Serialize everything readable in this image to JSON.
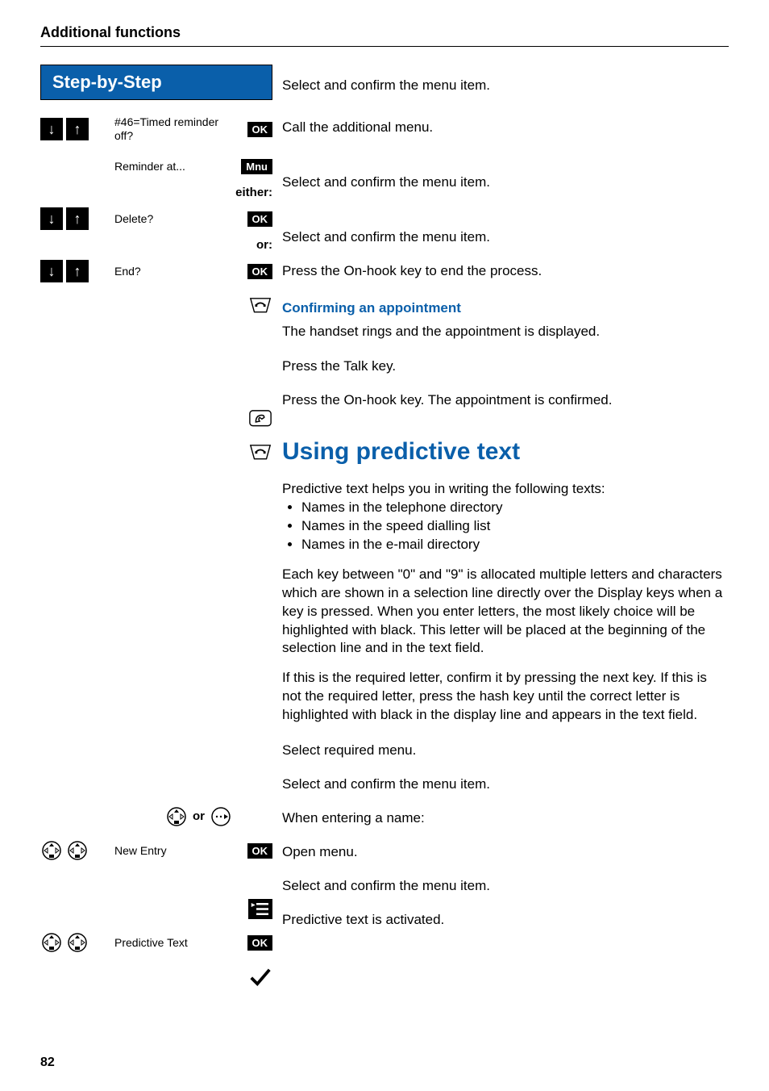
{
  "chapter": "Additional functions",
  "stepbox": "Step-by-Step",
  "left": {
    "row1_menu": "#46=Timed reminder off?",
    "row2_menu": "Reminder at...",
    "either": "either:",
    "row3_menu": "Delete?",
    "or": "or:",
    "row4_menu": "End?",
    "or2": "or",
    "new_entry": "New Entry",
    "predictive_text_item": "Predictive Text"
  },
  "buttons": {
    "ok": "OK",
    "mnu": "Mnu"
  },
  "right": {
    "r1": "Select and confirm the menu item.",
    "r2": "Call the additional menu.",
    "r3": "Select and confirm the menu item.",
    "r4": "Select and confirm the menu item.",
    "r5": "Press the On-hook key to end the process.",
    "subhead1": "Confirming an appointment",
    "r6": "The handset rings and the appointment is displayed.",
    "r7": "Press the Talk key.",
    "r8": "Press the On-hook key. The appointment is confirmed.",
    "h2": "Using predictive text",
    "p1": "Predictive text helps you in writing the following texts:",
    "b1": "Names in the telephone directory",
    "b2": "Names in the speed dialling list",
    "b3": "Names in the e-mail directory",
    "p2": "Each key between \"0\" and \"9\" is allocated multiple letters and characters which are shown in a selection line directly over the Display keys when a key is pressed. When you enter letters, the most likely choice will be highlighted with black. This letter will be placed at the beginning of the selection line and in the text field.",
    "p3": "If this is the required letter, confirm it by pressing the next key. If this is not the required letter, press the hash key until the correct letter is highlighted with black in the display line and appears in the text field.",
    "r9": "Select required menu.",
    "r10": "Select and confirm the menu item.",
    "r11": "When entering a name:",
    "r12": "Open menu.",
    "r13": "Select and confirm the menu item.",
    "r14": "Predictive text is activated."
  },
  "page": "82"
}
